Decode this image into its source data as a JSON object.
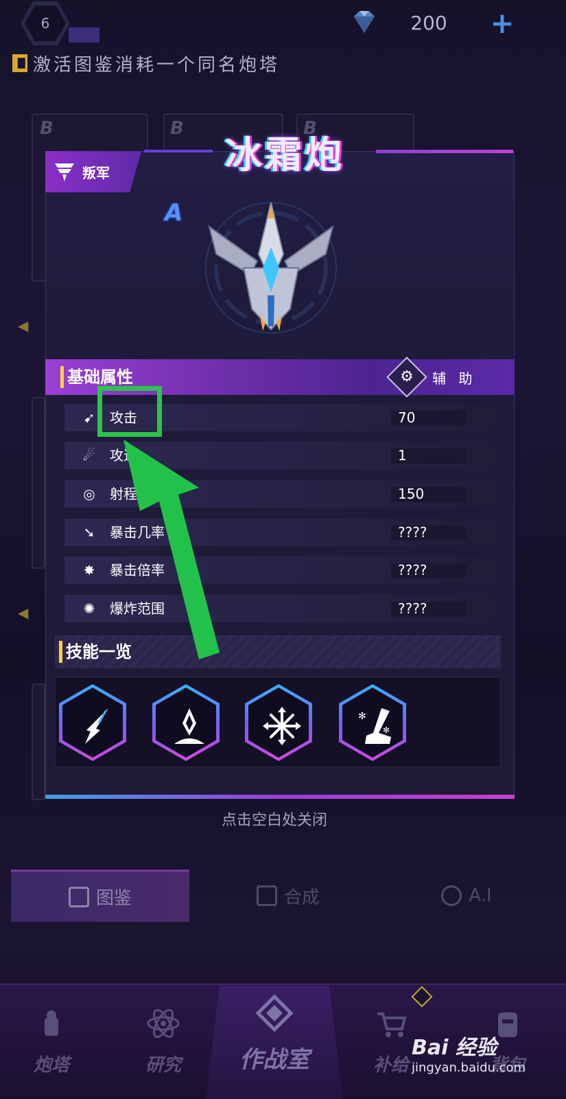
{
  "top_bar": {
    "level": "6",
    "diamond_count": "200",
    "plus_label": "+"
  },
  "tip": {
    "text": "激活图鉴消耗一个同名炮塔"
  },
  "background": {
    "grade_letters": [
      "B",
      "B",
      "B"
    ]
  },
  "modal": {
    "faction": "叛军",
    "tower_name": "冰霜炮",
    "rank": "A",
    "attributes_title": "基础属性",
    "role": "辅 助",
    "stats": [
      {
        "label": "攻击",
        "value": "70",
        "icon": "attack-icon"
      },
      {
        "label": "攻速",
        "value": "1",
        "icon": "attack-speed-icon"
      },
      {
        "label": "射程",
        "value": "150",
        "icon": "range-icon"
      },
      {
        "label": "暴击几率",
        "value": "????",
        "icon": "crit-chance-icon"
      },
      {
        "label": "暴击倍率",
        "value": "????",
        "icon": "crit-multiplier-icon"
      },
      {
        "label": "爆炸范围",
        "value": "????",
        "icon": "explosion-range-icon"
      }
    ],
    "skills_title": "技能一览",
    "skills": [
      "ice-shard-skill-icon",
      "crystal-burst-skill-icon",
      "snowflake-skill-icon",
      "frost-boot-skill-icon"
    ],
    "close_hint": "点击空白处关闭"
  },
  "sub_tabs": [
    {
      "label": "图鉴",
      "active": true
    },
    {
      "label": "合成",
      "active": false
    },
    {
      "label": "A.I",
      "active": false
    }
  ],
  "bottom_nav": [
    {
      "label": "炮塔"
    },
    {
      "label": "研究"
    },
    {
      "label": "作战室"
    },
    {
      "label": "补给"
    },
    {
      "label": "背包"
    }
  ],
  "watermark": {
    "brand": "Bai 经验",
    "url": "jingyan.baidu.com"
  },
  "colors": {
    "accent_purple": "#9a3fd4",
    "highlight_green": "#2ec24b",
    "gold": "#ffd23c"
  }
}
